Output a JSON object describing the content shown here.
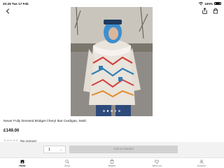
{
  "status_bar": {
    "time": "20:29",
    "date": "Tue 17 Feb",
    "battery": "100%"
  },
  "product": {
    "title": "Never Fully Dressed Bridget Cheryl Ikat Cardigan, Multi",
    "price": "£149.00",
    "rating_text": "(No reviews)",
    "rating_stars": "☆☆☆☆☆",
    "image_count": 5,
    "active_image": 1
  },
  "purchase": {
    "quantity": "1",
    "add_label": "Add to basket"
  },
  "tabs": [
    {
      "label": "Home",
      "icon": "home-icon"
    },
    {
      "label": "Shop",
      "icon": "search-icon"
    },
    {
      "label": "Basket",
      "icon": "basket-icon"
    },
    {
      "label": "Wish List",
      "icon": "heart-icon"
    },
    {
      "label": "Account",
      "icon": "account-icon"
    }
  ],
  "active_tab": "Home",
  "colors": {
    "tab_active": "#111111",
    "tab_inactive": "#777777",
    "action_bar_bg": "#f2f2f2",
    "button_disabled_bg": "#d2d2d2"
  }
}
